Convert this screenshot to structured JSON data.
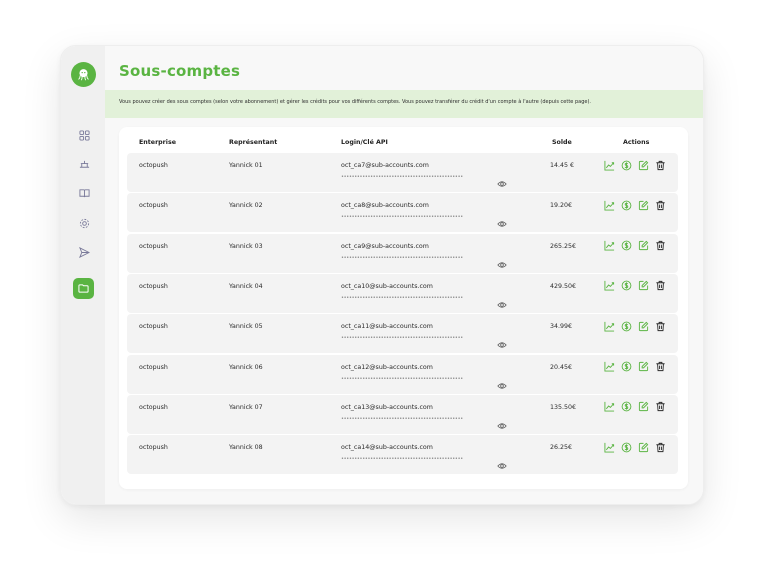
{
  "page": {
    "title": "Sous-comptes",
    "info": "Vous pouvez créer des sous comptes (selon votre abonnement) et gérer les crédits pour vos différents comptes. Vous pouvez transférer du crédit d'un compte à l'autre (depuis cette page)."
  },
  "sidebar": {
    "items": [
      {
        "icon": "grid-icon"
      },
      {
        "icon": "campaign-icon"
      },
      {
        "icon": "book-icon"
      },
      {
        "icon": "settings-icon"
      },
      {
        "icon": "send-icon"
      },
      {
        "icon": "folder-icon",
        "active": true
      }
    ]
  },
  "table": {
    "headers": [
      "Enterprise",
      "Représentant",
      "Login/Clé API",
      "Solde",
      "Actions"
    ],
    "masked_key": "••••••••••••••••••••••••••••••••••••••••••••••",
    "rows": [
      {
        "enterprise": "octopush",
        "rep": "Yannick 01",
        "login": "oct_ca7@sub-accounts.com",
        "solde": "14.45 €"
      },
      {
        "enterprise": "octopush",
        "rep": "Yannick 02",
        "login": "oct_ca8@sub-accounts.com",
        "solde": "19.20€"
      },
      {
        "enterprise": "octopush",
        "rep": "Yannick 03",
        "login": "oct_ca9@sub-accounts.com",
        "solde": "265.25€"
      },
      {
        "enterprise": "octopush",
        "rep": "Yannick 04",
        "login": "oct_ca10@sub-accounts.com",
        "solde": "429.50€"
      },
      {
        "enterprise": "octopush",
        "rep": "Yannick 05",
        "login": "oct_ca11@sub-accounts.com",
        "solde": "34.99€"
      },
      {
        "enterprise": "octopush",
        "rep": "Yannick 06",
        "login": "oct_ca12@sub-accounts.com",
        "solde": "20.45€"
      },
      {
        "enterprise": "octopush",
        "rep": "Yannick 07",
        "login": "oct_ca13@sub-accounts.com",
        "solde": "135.50€"
      },
      {
        "enterprise": "octopush",
        "rep": "Yannick 08",
        "login": "oct_ca14@sub-accounts.com",
        "solde": "26.25€"
      }
    ],
    "actions": [
      "chart-icon",
      "credit-icon",
      "edit-icon",
      "delete-icon"
    ]
  },
  "colors": {
    "accent": "#5ab442",
    "banner": "#e2f1d9"
  }
}
